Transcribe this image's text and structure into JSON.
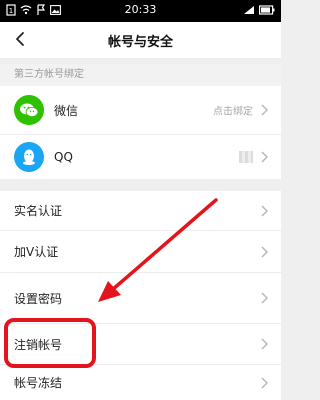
{
  "status_bar": {
    "time": "20:33"
  },
  "nav": {
    "title": "帐号与安全"
  },
  "third_party": {
    "header": "第三方帐号绑定",
    "items": [
      {
        "label": "微信",
        "action": "点击绑定",
        "icon": "wechat-icon",
        "color": "#2dc100"
      },
      {
        "label": "QQ",
        "icon": "qq-icon",
        "color": "#1aa6f4"
      }
    ]
  },
  "menu": {
    "items": [
      {
        "label": "实名认证"
      },
      {
        "label": "加V认证"
      },
      {
        "label": "设置密码"
      },
      {
        "label": "注销帐号"
      },
      {
        "label": "帐号冻结"
      }
    ]
  },
  "annotation": {
    "highlight_color": "#e3141c"
  }
}
